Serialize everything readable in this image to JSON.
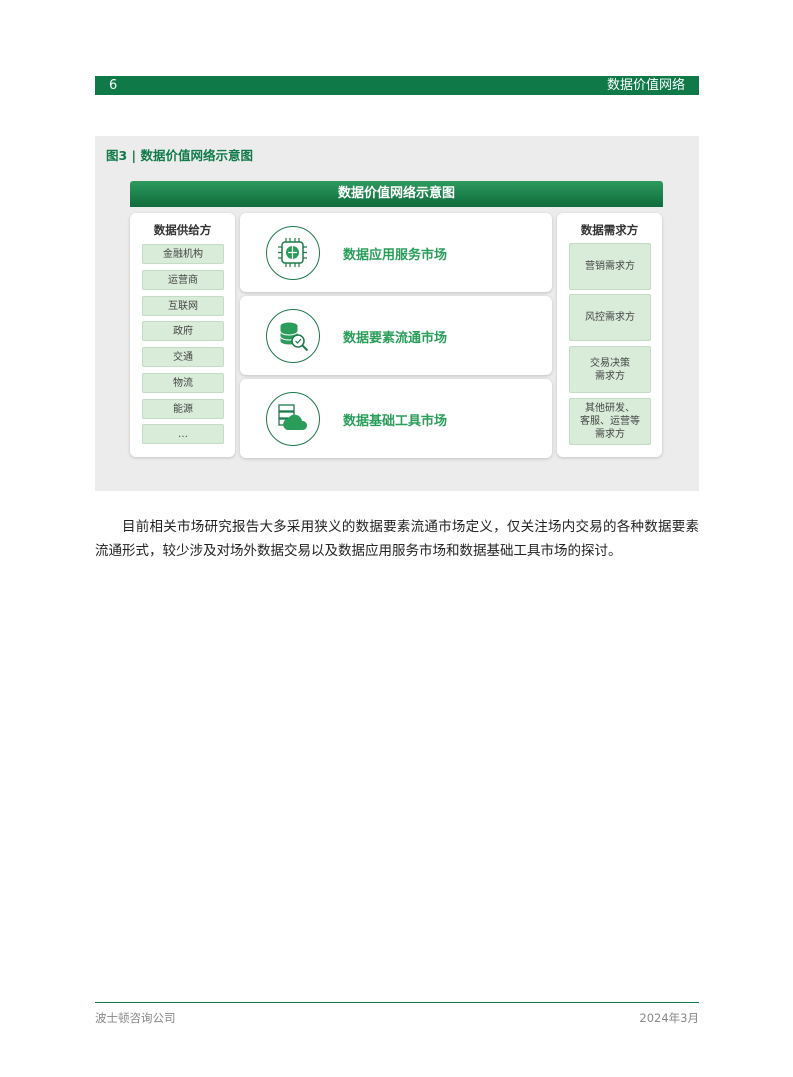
{
  "header": {
    "page_number": "6",
    "section_title": "数据价值网络"
  },
  "figure": {
    "caption": "图3 | 数据价值网络示意图",
    "diagram_title": "数据价值网络示意图",
    "supply": {
      "title": "数据供给方",
      "items": [
        "金融机构",
        "运营商",
        "互联网",
        "政府",
        "交通",
        "物流",
        "能源",
        "…"
      ]
    },
    "markets": [
      {
        "label": "数据应用服务市场",
        "icon": "chip-icon"
      },
      {
        "label": "数据要素流通市场",
        "icon": "database-icon"
      },
      {
        "label": "数据基础工具市场",
        "icon": "cloud-server-icon"
      }
    ],
    "demand": {
      "title": "数据需求方",
      "items": [
        "营销需求方",
        "风控需求方",
        "交易决策\n需求方",
        "其他研发、\n客服、运营等\n需求方"
      ]
    }
  },
  "body_text": "目前相关市场研究报告大多采用狭义的数据要素流通市场定义，仅关注场内交易的各种数据要素流通形式，较少涉及对场外数据交易以及数据应用服务市场和数据基础工具市场的探讨。",
  "footer": {
    "publisher": "波士顿咨询公司",
    "date": "2024年3月"
  },
  "colors": {
    "brand_green": "#0f7a48",
    "label_green": "#2a9d5a",
    "chip_bg": "#d9ecd9"
  }
}
